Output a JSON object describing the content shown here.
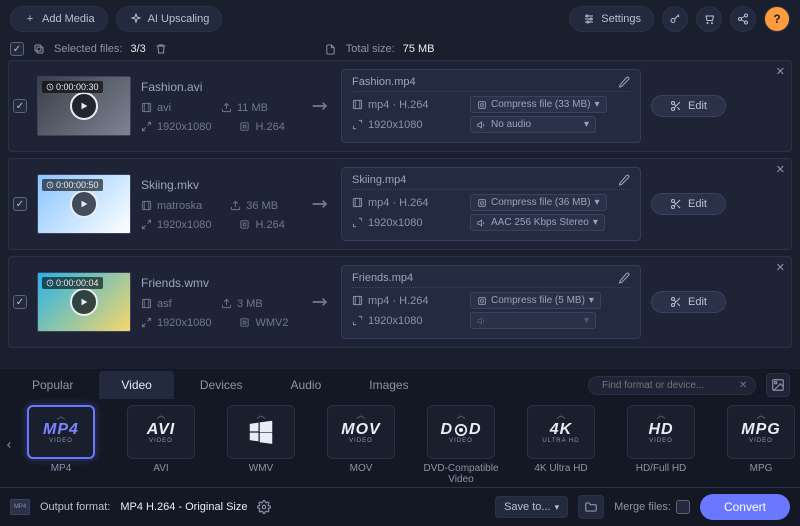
{
  "topbar": {
    "add_media": "Add Media",
    "ai_upscaling": "AI Upscaling",
    "settings": "Settings"
  },
  "selbar": {
    "selected_label": "Selected files:",
    "selected_count": "3/3",
    "total_size_label": "Total size:",
    "total_size_value": "75 MB"
  },
  "files": [
    {
      "thumb_colors": [
        "#3a3f4a",
        "#7d8391"
      ],
      "duration": "0:00:00:30",
      "src_name": "Fashion.avi",
      "src_container": "avi",
      "src_size": "11 MB",
      "src_res": "1920x1080",
      "src_codec": "H.264",
      "out_name": "Fashion.mp4",
      "out_format": "mp4 · H.264",
      "out_compress": "Compress file (33 MB)",
      "out_res": "1920x1080",
      "out_audio": "No audio"
    },
    {
      "thumb_colors": [
        "#89c4ff",
        "#ffffff"
      ],
      "duration": "0:00:00:50",
      "src_name": "Skiing.mkv",
      "src_container": "matroska",
      "src_size": "36 MB",
      "src_res": "1920x1080",
      "src_codec": "H.264",
      "out_name": "Skiing.mp4",
      "out_format": "mp4 · H.264",
      "out_compress": "Compress file (36 MB)",
      "out_res": "1920x1080",
      "out_audio": "AAC 256 Kbps Stereo"
    },
    {
      "thumb_colors": [
        "#27b3e6",
        "#f6d76a"
      ],
      "duration": "0:00:00:04",
      "src_name": "Friends.wmv",
      "src_container": "asf",
      "src_size": "3 MB",
      "src_res": "1920x1080",
      "src_codec": "WMV2",
      "out_name": "Friends.mp4",
      "out_format": "mp4 · H.264",
      "out_compress": "Compress file (5 MB)",
      "out_res": "1920x1080",
      "out_audio": ""
    }
  ],
  "edit_label": "Edit",
  "tabs": {
    "popular": "Popular",
    "video": "Video",
    "devices": "Devices",
    "audio": "Audio",
    "images": "Images"
  },
  "search_placeholder": "Find format or device...",
  "formats": [
    {
      "main": "MP4",
      "sub": "VIDEO",
      "label": "MP4",
      "active": true,
      "kind": "mp4"
    },
    {
      "main": "AVI",
      "sub": "VIDEO",
      "label": "AVI"
    },
    {
      "main": "WIN",
      "sub": "",
      "label": "WMV",
      "kind": "wmv"
    },
    {
      "main": "MOV",
      "sub": "VIDEO",
      "label": "MOV"
    },
    {
      "main": "DVD",
      "sub": "VIDEO",
      "label": "DVD-Compatible Video",
      "kind": "dvd"
    },
    {
      "main": "4K",
      "sub": "ULTRA HD",
      "label": "4K Ultra HD"
    },
    {
      "main": "HD",
      "sub": "VIDEO",
      "label": "HD/Full HD"
    },
    {
      "main": "MPG",
      "sub": "VIDEO",
      "label": "MPG"
    }
  ],
  "bottom": {
    "output_label": "Output format:",
    "output_value": "MP4 H.264 - Original Size",
    "save_to": "Save to...",
    "merge_label": "Merge files:",
    "convert": "Convert"
  }
}
